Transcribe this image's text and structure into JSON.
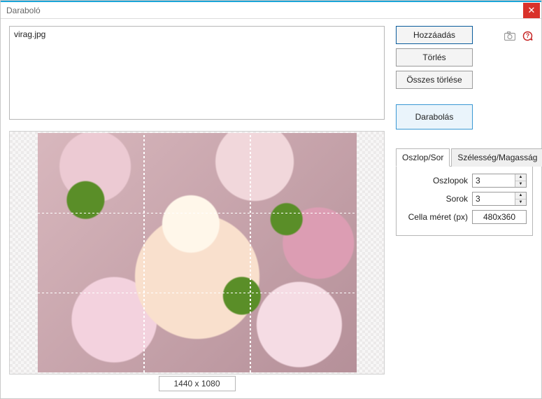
{
  "window": {
    "title": "Daraboló"
  },
  "file_list": {
    "items": [
      "virag.jpg"
    ]
  },
  "actions": {
    "add": "Hozzáadás",
    "delete": "Törlés",
    "delete_all": "Összes törlése",
    "slice": "Darabolás"
  },
  "icons": {
    "camera": "camera-icon",
    "help": "help-icon"
  },
  "preview": {
    "image_name": "virag.jpg",
    "original_size": "1440 x 1080",
    "grid": {
      "cols": 3,
      "rows": 3
    }
  },
  "tabs": {
    "active": 0,
    "items": [
      {
        "label": "Oszlop/Sor"
      },
      {
        "label": "Szélesség/Magasság"
      }
    ]
  },
  "form": {
    "columns_label": "Oszlopok",
    "columns_value": "3",
    "rows_label": "Sorok",
    "rows_value": "3",
    "cell_size_label": "Cella méret (px)",
    "cell_size_value": "480x360"
  }
}
